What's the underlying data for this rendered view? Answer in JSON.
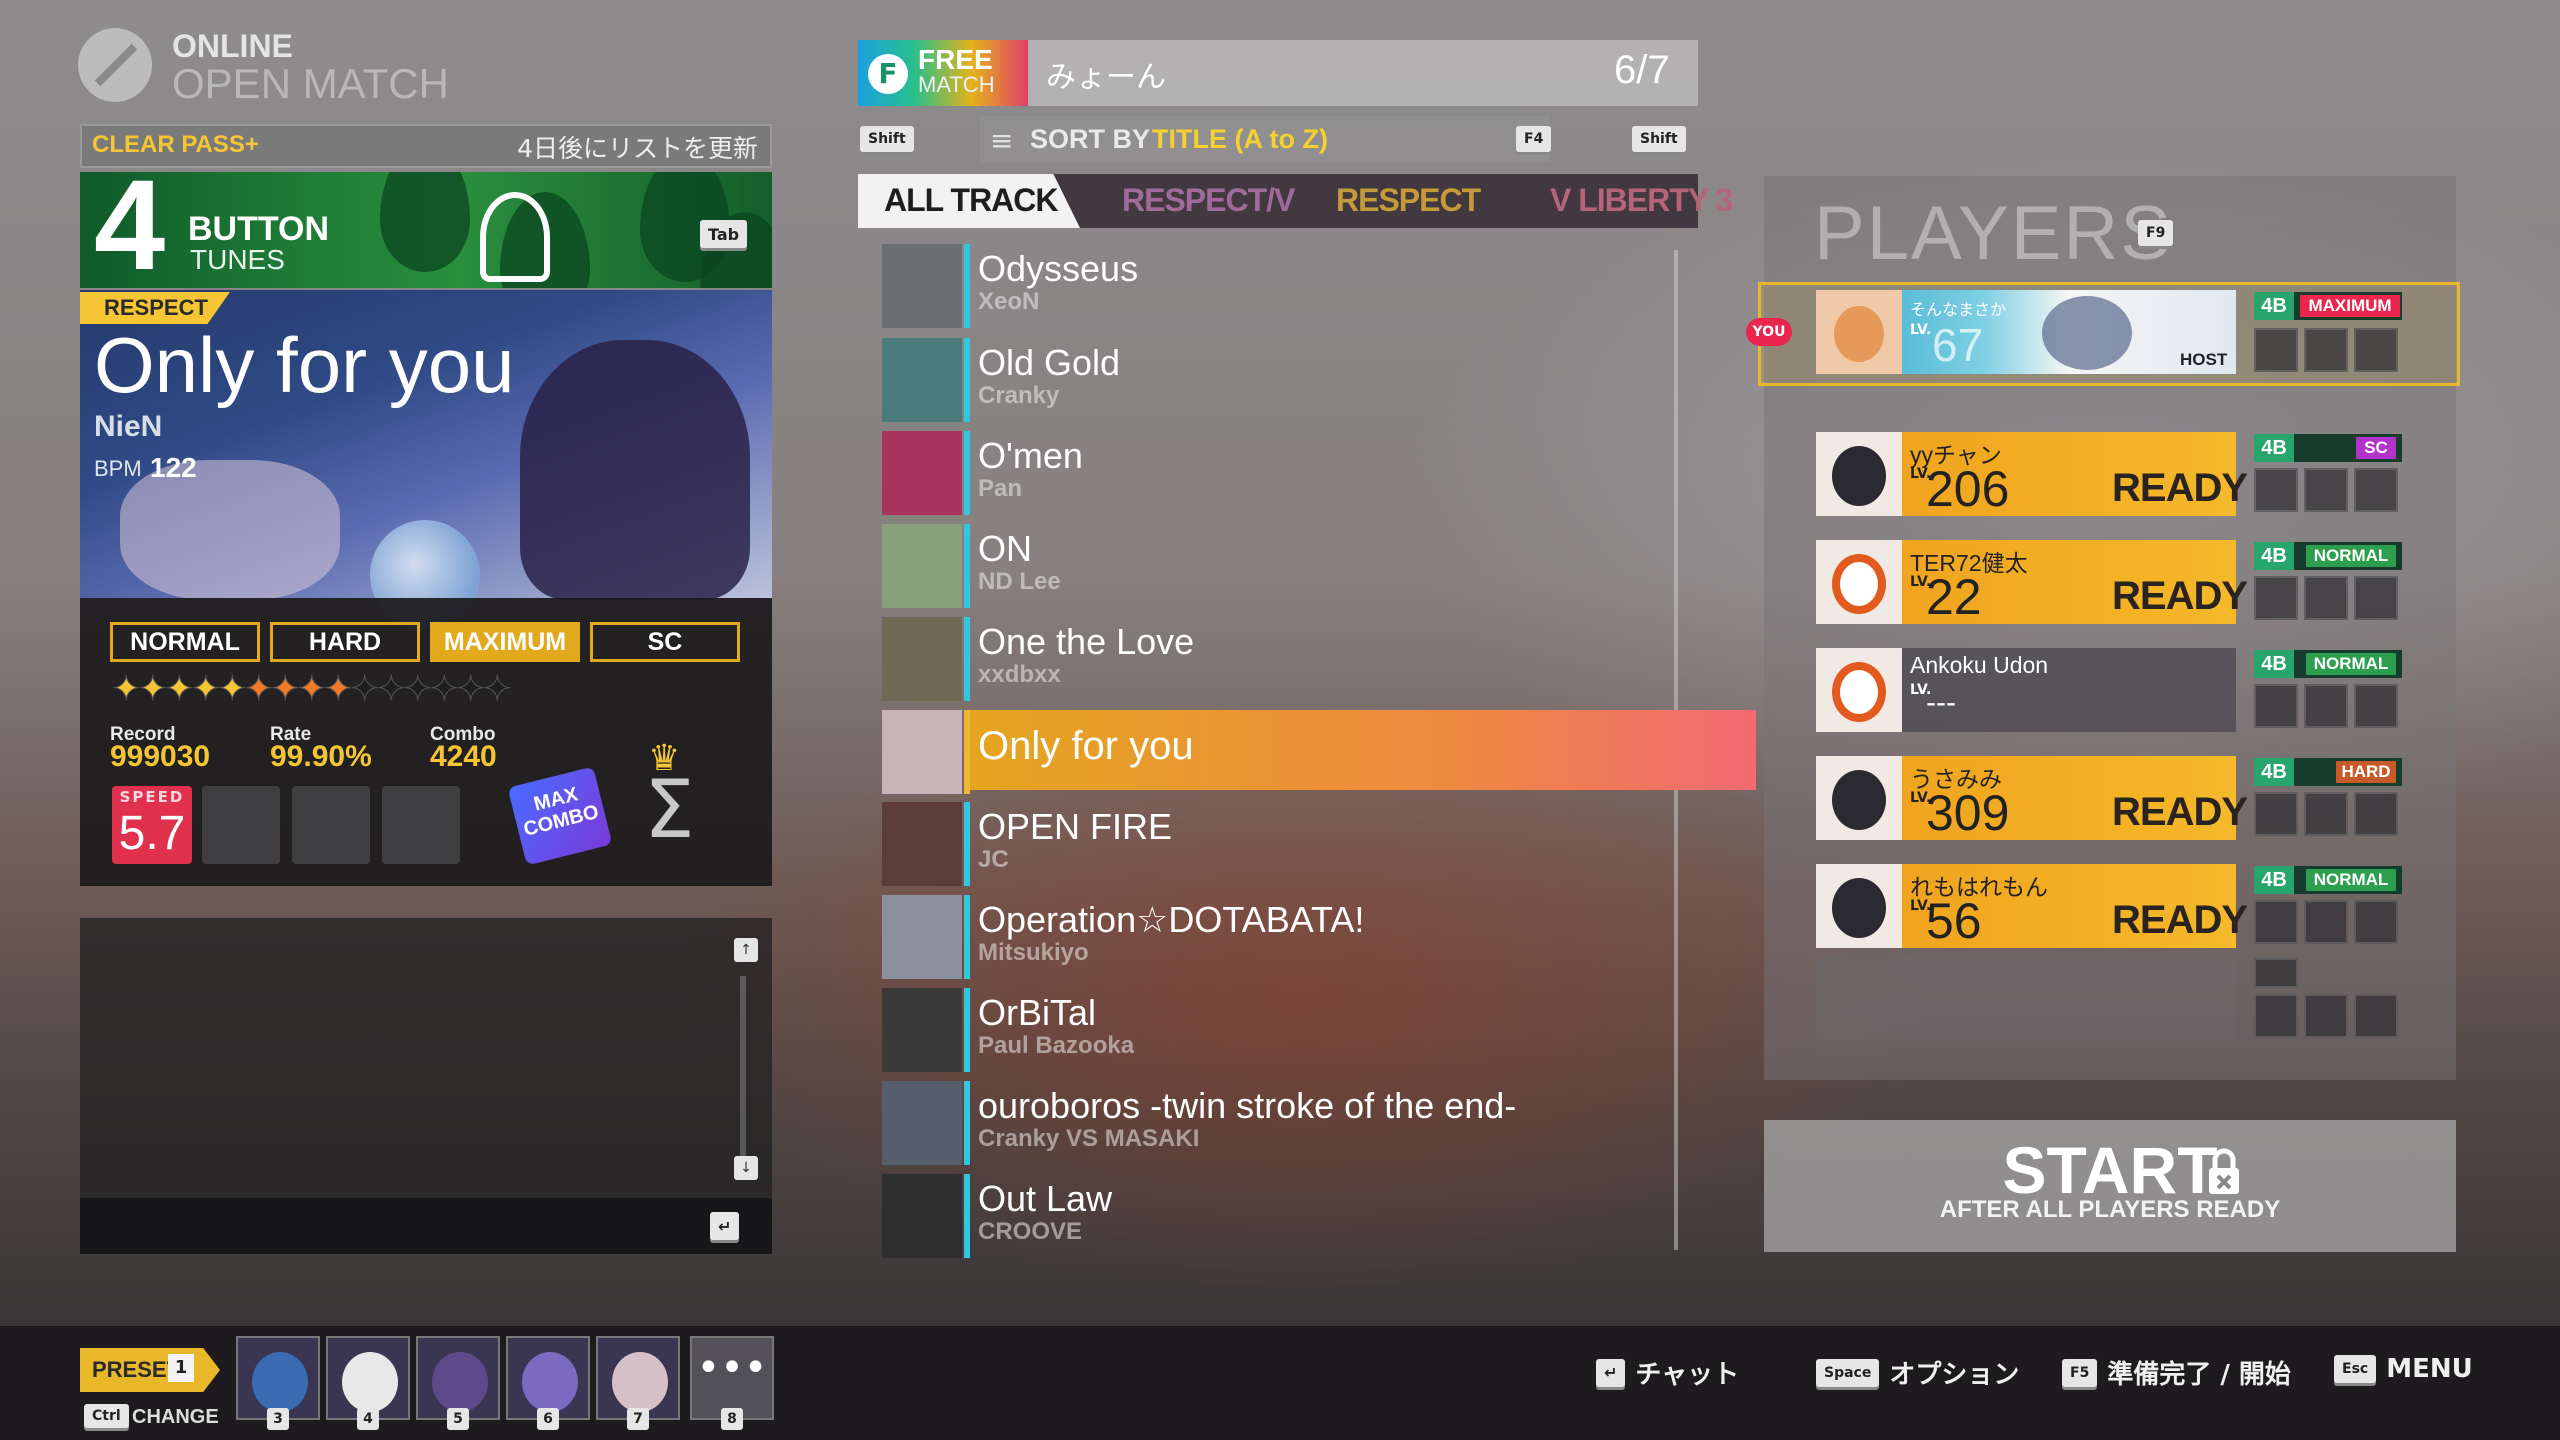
{
  "header": {
    "mode_line1": "ONLINE",
    "mode_line2": "OPEN MATCH"
  },
  "left_panel": {
    "clear_pass": "CLEAR PASS+",
    "list_update_notice": "4日後にリストを更新",
    "tunes": {
      "number": "4",
      "button": "BUTTON",
      "tunes": "TUNES",
      "tab_key": "Tab"
    },
    "song": {
      "category": "RESPECT",
      "title": "Only for you",
      "artist": "NieN",
      "bpm_label": "BPM",
      "bpm": "122"
    },
    "difficulties": [
      {
        "label": "NORMAL",
        "active": false
      },
      {
        "label": "HARD",
        "active": false
      },
      {
        "label": "MAXIMUM",
        "active": true
      },
      {
        "label": "SC",
        "active": false
      }
    ],
    "star_rating": {
      "lit_yellow": 5,
      "lit_orange": 4,
      "total": 15
    },
    "stats": {
      "record_label": "Record",
      "record": "999030",
      "rate_label": "Rate",
      "rate": "99.90%",
      "combo_label": "Combo",
      "combo": "4240"
    },
    "speed": {
      "label": "SPEED",
      "value": "5.7"
    },
    "max_combo_badge": "MAX COMBO"
  },
  "chat": {
    "enter_key": "↵",
    "scroll_up": "↑",
    "scroll_down": "↓"
  },
  "match_bar": {
    "free_line1": "FREE",
    "free_line2": "MATCH",
    "free_letter": "F",
    "room_name": "みょーん",
    "player_count": "6/7"
  },
  "sort": {
    "shift_key": "Shift",
    "label": "SORT BY",
    "value": "TITLE (A to Z)",
    "f4_key": "F4"
  },
  "tabs": [
    {
      "label": "ALL TRACK",
      "color": "#1e1e1e"
    },
    {
      "label": "RESPECT/V",
      "color": "#a06b9a"
    },
    {
      "label": "RESPECT",
      "color": "#c49a3a"
    },
    {
      "label": "V LIBERTY 3",
      "color": "#b5647a"
    }
  ],
  "songs": [
    {
      "title": "Odysseus",
      "artist": "XeoN",
      "accent": "#2fc8e0",
      "thumb": "#6c6f72"
    },
    {
      "title": "Old Gold",
      "artist": "Cranky",
      "accent": "#2fc8e0",
      "thumb": "#4b7a7a"
    },
    {
      "title": "O'men",
      "artist": "Pan",
      "accent": "#2fc8e0",
      "thumb": "#a8345e"
    },
    {
      "title": "ON",
      "artist": "ND Lee",
      "accent": "#2fc8e0",
      "thumb": "#8aa07a"
    },
    {
      "title": "One the Love",
      "artist": "xxdbxx",
      "accent": "#2fc8e0",
      "thumb": "#6f6a55"
    },
    {
      "title": "Only for you",
      "artist": "",
      "accent": "#f0b830",
      "thumb": "#c9b3b8",
      "selected": true
    },
    {
      "title": "OPEN FIRE",
      "artist": "JC",
      "accent": "#2fc8e0",
      "thumb": "#5b3c38"
    },
    {
      "title": "Operation☆DOTABATA!",
      "artist": "Mitsukiyo",
      "accent": "#2fc8e0",
      "thumb": "#8c8f9c"
    },
    {
      "title": "OrBiTal",
      "artist": "Paul Bazooka",
      "accent": "#2fc8e0",
      "thumb": "#3a3a3a"
    },
    {
      "title": "ouroboros -twin stroke of the end-",
      "artist": "Cranky VS MASAKI",
      "accent": "#2fc8e0",
      "thumb": "#555f6c"
    },
    {
      "title": "Out Law",
      "artist": "CROOVE",
      "accent": "#2fc8e0",
      "thumb": "#2e2e2e"
    }
  ],
  "players": {
    "title": "PLAYERS",
    "f9_key": "F9",
    "host": {
      "you_tag": "YOU",
      "name": "そんなまさか",
      "lv_label": "LV.",
      "level": "67",
      "host_label": "HOST",
      "mode": "4B",
      "difficulty": "MAXIMUM",
      "difficulty_color": "#e8264e"
    },
    "list": [
      {
        "name": "yyチャン",
        "lv_label": "LV.",
        "level": "206",
        "status": "READY",
        "mode": "4B",
        "difficulty": "SC",
        "difficulty_color": "#b233c9",
        "avatar_color": "#2a2a30"
      },
      {
        "name": "TER72健太",
        "lv_label": "LV.",
        "level": "22",
        "status": "READY",
        "mode": "4B",
        "difficulty": "NORMAL",
        "difficulty_color": "#2d9e4d",
        "avatar_color": "astro"
      },
      {
        "name": "Ankoku Udon",
        "lv_label": "LV.",
        "level": "---",
        "status": "",
        "mode": "4B",
        "difficulty": "NORMAL",
        "difficulty_color": "#2d9e4d",
        "avatar_color": "astro"
      },
      {
        "name": "うさみみ",
        "lv_label": "LV.",
        "level": "309",
        "status": "READY",
        "mode": "4B",
        "difficulty": "HARD",
        "difficulty_color": "#c75a2a",
        "avatar_color": "#2a2a40"
      },
      {
        "name": "れもはれもん",
        "lv_label": "LV.",
        "level": "56",
        "status": "READY",
        "mode": "4B",
        "difficulty": "NORMAL",
        "difficulty_color": "#2d9e4d",
        "avatar_color": "#3a2a28"
      }
    ]
  },
  "start": {
    "label": "START",
    "sub": "AFTER ALL PLAYERS READY"
  },
  "bottom": {
    "preset_label": "PRESET",
    "preset_num": "1",
    "ctrl_key": "Ctrl",
    "change_label": "CHANGE",
    "presets": [
      {
        "num": "3",
        "color": "#3b6bb0"
      },
      {
        "num": "4",
        "color": "#e8e8e8"
      },
      {
        "num": "5",
        "color": "#5e4a8a"
      },
      {
        "num": "6",
        "color": "#7a6ac0"
      },
      {
        "num": "7",
        "color": "#d8c0c8"
      }
    ],
    "more_label": "•••",
    "more_num": "8",
    "hints": [
      {
        "key": "↵",
        "label": "チャット"
      },
      {
        "key": "Space",
        "label": "オプション"
      },
      {
        "key": "F5",
        "label": "準備完了 / 開始"
      },
      {
        "key": "Esc",
        "label": "MENU"
      }
    ]
  }
}
